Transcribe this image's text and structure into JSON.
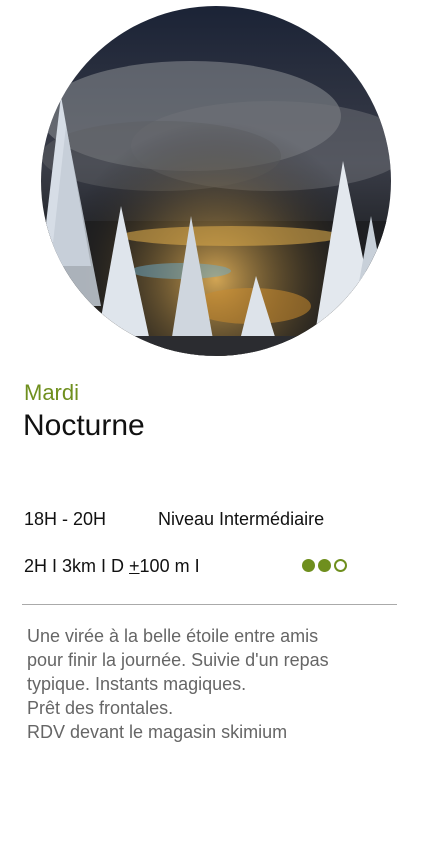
{
  "card": {
    "photo_alt": "night-snow-ski-resort-photo",
    "day": "Mardi",
    "title": "Nocturne",
    "schedule": "18H - 20H",
    "level": "Niveau Intermédiaire",
    "stats": {
      "part1": "2H I 3km I D ",
      "plusminus": "+",
      "part2": "100 m I"
    },
    "difficulty": {
      "level": 2,
      "max": 3
    },
    "description_lines": [
      "Une virée à la belle étoile entre amis",
      "pour finir la journée. Suivie d'un repas",
      "typique. Instants magiques.",
      "Prêt des frontales.",
      "RDV devant le magasin skimium"
    ]
  },
  "colors": {
    "accent": "#6f8f1e",
    "text": "#111111",
    "muted": "#666666"
  }
}
